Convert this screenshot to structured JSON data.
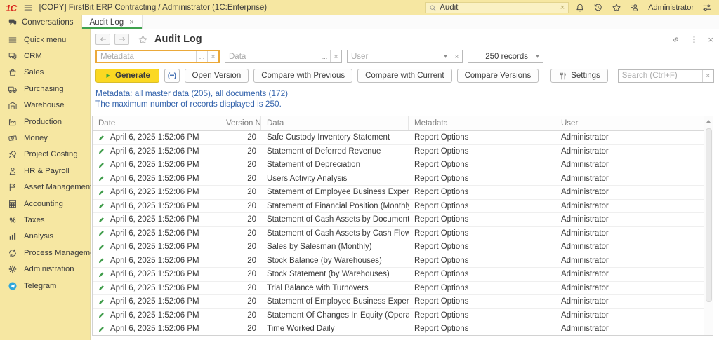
{
  "window": {
    "logo": "1С",
    "title": "[COPY] FirstBit ERP Contracting / Administrator  (1C:Enterprise)",
    "search_value": "Audit",
    "user_label": "Administrator"
  },
  "tabs": {
    "conversations": "Conversations",
    "audit_log": "Audit Log"
  },
  "sidebar": {
    "items": [
      {
        "label": "Quick menu",
        "icon": "quick-menu"
      },
      {
        "label": "CRM",
        "icon": "crm"
      },
      {
        "label": "Sales",
        "icon": "sales"
      },
      {
        "label": "Purchasing",
        "icon": "purchasing"
      },
      {
        "label": "Warehouse",
        "icon": "warehouse"
      },
      {
        "label": "Production",
        "icon": "production"
      },
      {
        "label": "Money",
        "icon": "money"
      },
      {
        "label": "Project Costing",
        "icon": "project-costing"
      },
      {
        "label": "HR & Payroll",
        "icon": "hr-payroll"
      },
      {
        "label": "Asset Management",
        "icon": "asset-management"
      },
      {
        "label": "Accounting",
        "icon": "accounting"
      },
      {
        "label": "Taxes",
        "icon": "taxes"
      },
      {
        "label": "Analysis",
        "icon": "analysis"
      },
      {
        "label": "Process Management",
        "icon": "process-management"
      },
      {
        "label": "Administration",
        "icon": "administration"
      },
      {
        "label": "Telegram",
        "icon": "telegram"
      }
    ]
  },
  "page": {
    "title": "Audit Log",
    "filters": {
      "metadata_placeholder": "Metadata",
      "data_placeholder": "Data",
      "user_placeholder": "User",
      "records_value": "250 records"
    },
    "toolbar": {
      "generate": "Generate",
      "broadcast": "(••)",
      "open_version": "Open Version",
      "compare_previous": "Compare with Previous",
      "compare_current": "Compare with Current",
      "compare_versions": "Compare Versions",
      "settings": "Settings",
      "search_placeholder": "Search (Ctrl+F)",
      "more_actions": "More actions"
    },
    "info": [
      "Metadata: all master data (205), all documents (172)",
      "The maximum number of records displayed is 250."
    ],
    "table": {
      "columns": [
        "Date",
        "Version No.",
        "Data",
        "Metadata",
        "User"
      ],
      "rows": [
        {
          "date": "April 6, 2025 1:52:06 PM",
          "version": "20",
          "data": "Safe Custody Inventory Statement",
          "metadata": "Report Options",
          "user": "Administrator"
        },
        {
          "date": "April 6, 2025 1:52:06 PM",
          "version": "20",
          "data": "Statement of Deferred Revenue",
          "metadata": "Report Options",
          "user": "Administrator"
        },
        {
          "date": "April 6, 2025 1:52:06 PM",
          "version": "20",
          "data": "Statement of Depreciation",
          "metadata": "Report Options",
          "user": "Administrator"
        },
        {
          "date": "April 6, 2025 1:52:06 PM",
          "version": "20",
          "data": "Users Activity Analysis",
          "metadata": "Report Options",
          "user": "Administrator"
        },
        {
          "date": "April 6, 2025 1:52:06 PM",
          "version": "20",
          "data": "Statement of Employee Business Expenses (in …",
          "metadata": "Report Options",
          "user": "Administrator"
        },
        {
          "date": "April 6, 2025 1:52:06 PM",
          "version": "20",
          "data": "Statement of Financial Position (Monthly)",
          "metadata": "Report Options",
          "user": "Administrator"
        },
        {
          "date": "April 6, 2025 1:52:06 PM",
          "version": "20",
          "data": "Statement of Cash Assets by Documents",
          "metadata": "Report Options",
          "user": "Administrator"
        },
        {
          "date": "April 6, 2025 1:52:06 PM",
          "version": "20",
          "data": "Statement of Cash Assets by Cash Flow Items (…",
          "metadata": "Report Options",
          "user": "Administrator"
        },
        {
          "date": "April 6, 2025 1:52:06 PM",
          "version": "20",
          "data": "Sales by Salesman (Monthly)",
          "metadata": "Report Options",
          "user": "Administrator"
        },
        {
          "date": "April 6, 2025 1:52:06 PM",
          "version": "20",
          "data": "Stock Balance (by Warehouses)",
          "metadata": "Report Options",
          "user": "Administrator"
        },
        {
          "date": "April 6, 2025 1:52:06 PM",
          "version": "20",
          "data": "Stock Statement (by Warehouses)",
          "metadata": "Report Options",
          "user": "Administrator"
        },
        {
          "date": "April 6, 2025 1:52:06 PM",
          "version": "20",
          "data": "Trial Balance with Turnovers",
          "metadata": "Report Options",
          "user": "Administrator"
        },
        {
          "date": "April 6, 2025 1:52:06 PM",
          "version": "20",
          "data": "Statement of Employee Business Expenses (in …",
          "metadata": "Report Options",
          "user": "Administrator"
        },
        {
          "date": "April 6, 2025 1:52:06 PM",
          "version": "20",
          "data": "Statement Of Changes In Equity (Operational)",
          "metadata": "Report Options",
          "user": "Administrator"
        },
        {
          "date": "April 6, 2025 1:52:06 PM",
          "version": "20",
          "data": "Time Worked Daily",
          "metadata": "Report Options",
          "user": "Administrator"
        }
      ]
    }
  },
  "glyphs": {
    "close": "×",
    "ellipsis": "...",
    "dropdown": "▾"
  },
  "colors": {
    "topbar_yellow": "#f6e7a2",
    "generate_yellow": "#fbd822",
    "filter_highlight": "#eba93a",
    "link_blue": "#3665ad",
    "pencil_green": "#3f9c4a",
    "tab_underline_green": "#3fa24e"
  }
}
